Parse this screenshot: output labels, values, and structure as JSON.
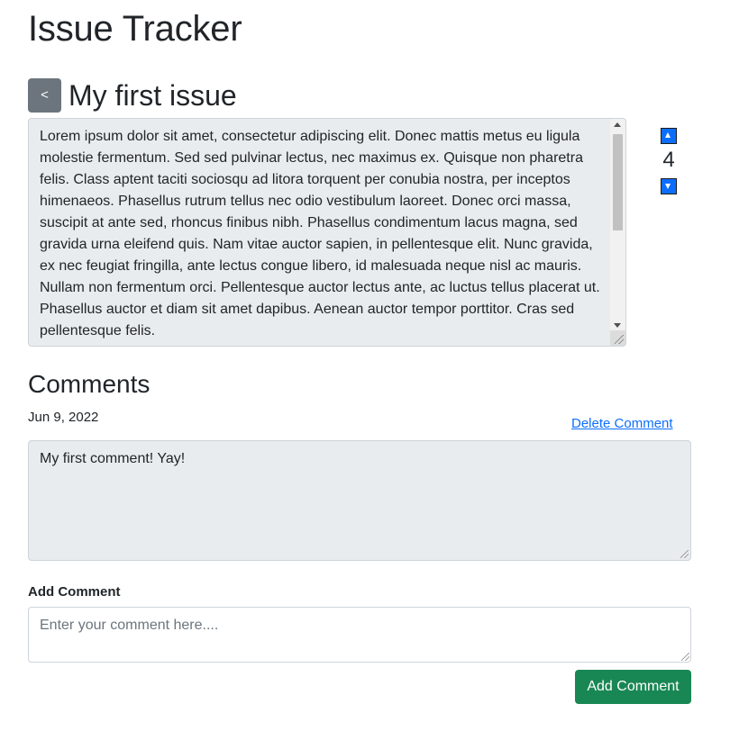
{
  "app": {
    "title": "Issue Tracker"
  },
  "issue": {
    "back_label": "<",
    "title": "My first issue",
    "body": "Lorem ipsum dolor sit amet, consectetur adipiscing elit. Donec mattis metus eu ligula molestie fermentum. Sed sed pulvinar lectus, nec maximus ex. Quisque non pharetra felis. Class aptent taciti sociosqu ad litora torquent per conubia nostra, per inceptos himenaeos. Phasellus rutrum tellus nec odio vestibulum laoreet. Donec orci massa, suscipit at ante sed, rhoncus finibus nibh. Phasellus condimentum lacus magna, sed gravida urna eleifend quis. Nam vitae auctor sapien, in pellentesque elit. Nunc gravida, ex nec feugiat fringilla, ante lectus congue libero, id malesuada neque nisl ac mauris. Nullam non fermentum orci. Pellentesque auctor lectus ante, ac luctus tellus placerat ut. Phasellus auctor et diam sit amet dapibus. Aenean auctor tempor porttitor. Cras sed pellentesque felis.",
    "votes": "4",
    "upvote_icon": "triangle-up-icon",
    "downvote_icon": "triangle-down-icon"
  },
  "comments": {
    "title": "Comments",
    "items": [
      {
        "date": "Jun 9, 2022",
        "delete_label": "Delete Comment",
        "text": "My first comment! Yay!"
      }
    ]
  },
  "add_comment": {
    "label": "Add Comment",
    "placeholder": "Enter your comment here....",
    "value": "",
    "button_label": "Add Comment"
  },
  "colors": {
    "primary": "#0d6efd",
    "success": "#198754",
    "secondary": "#6c757d",
    "readonly_bg": "#e9ecef"
  }
}
